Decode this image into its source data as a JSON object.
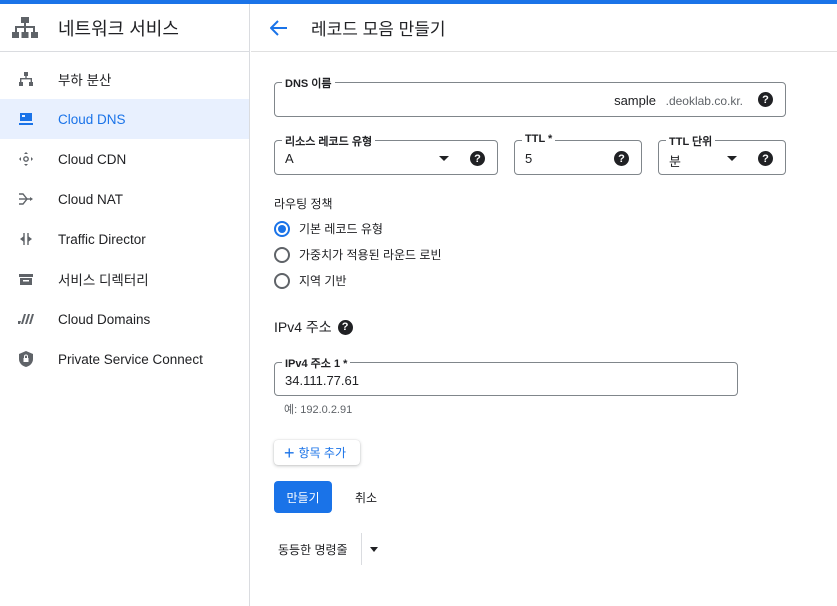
{
  "sidebar": {
    "title": "네트워크 서비스",
    "items": [
      {
        "label": "부하 분산",
        "icon": "load-balancing-icon"
      },
      {
        "label": "Cloud DNS",
        "icon": "dns-icon",
        "active": true
      },
      {
        "label": "Cloud CDN",
        "icon": "cdn-icon"
      },
      {
        "label": "Cloud NAT",
        "icon": "nat-icon"
      },
      {
        "label": "Traffic Director",
        "icon": "traffic-director-icon"
      },
      {
        "label": "서비스 디렉터리",
        "icon": "service-directory-icon"
      },
      {
        "label": "Cloud Domains",
        "icon": "domains-icon"
      },
      {
        "label": "Private Service Connect",
        "icon": "private-service-connect-icon"
      }
    ]
  },
  "header": {
    "title": "레코드 모음 만들기"
  },
  "form": {
    "dns_name": {
      "label": "DNS 이름",
      "value": "sample",
      "suffix": ".deoklab.co.kr."
    },
    "record_type": {
      "label": "리소스 레코드 유형",
      "value": "A"
    },
    "ttl": {
      "label": "TTL *",
      "value": "5"
    },
    "ttl_unit": {
      "label": "TTL 단위",
      "value": "분"
    },
    "routing": {
      "label": "라우팅 정책",
      "options": [
        "기본 레코드 유형",
        "가중치가 적용된 라운드 로빈",
        "지역 기반"
      ],
      "selected": 0
    },
    "ipv4": {
      "heading": "IPv4 주소",
      "field_label": "IPv4 주소 1 *",
      "value": "34.111.77.61",
      "hint": "예: 192.0.2.91"
    },
    "add_item_label": "항목 추가",
    "create_label": "만들기",
    "cancel_label": "취소",
    "equivalent_cmd_label": "동등한 명령줄"
  },
  "colors": {
    "accent": "#1a73e8",
    "active_bg": "#e8f0fe"
  }
}
